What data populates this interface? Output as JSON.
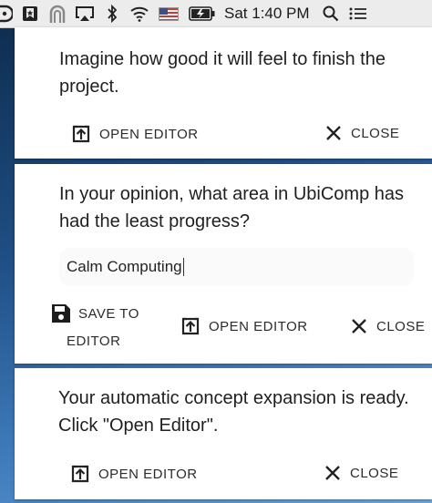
{
  "menubar": {
    "icons": [
      "dropbox-icon",
      "bookmark-app-icon",
      "nook-app-icon",
      "airplay-icon",
      "bluetooth-icon",
      "wifi-icon",
      "us-flag-icon",
      "battery-charging-icon",
      "search-icon",
      "list-icon"
    ],
    "clock": "Sat 1:40 PM"
  },
  "notifications": [
    {
      "message_line1": "Imagine how good it will feel to finish the",
      "message_line2": "project.",
      "open_editor_label": "OPEN EDITOR",
      "close_label": "CLOSE"
    },
    {
      "message_line1": "In your opinion, what area in UbiComp has",
      "message_line2": "had the least progress?",
      "input_value": "Calm Computing",
      "save_label_line1": "SAVE TO",
      "save_label_line2": "EDITOR",
      "open_editor_label": "OPEN EDITOR",
      "close_label": "CLOSE"
    },
    {
      "message_line1": "Your automatic concept expansion is ready.",
      "message_line2": "Click \"Open Editor\".",
      "open_editor_label": "OPEN EDITOR",
      "close_label": "CLOSE"
    }
  ],
  "colors": {
    "card_background": "#ffffff",
    "text": "#1f1f1f",
    "button_text": "#2b2b2b",
    "input_background": "#fafafa",
    "menubar_background": "#ececec"
  }
}
